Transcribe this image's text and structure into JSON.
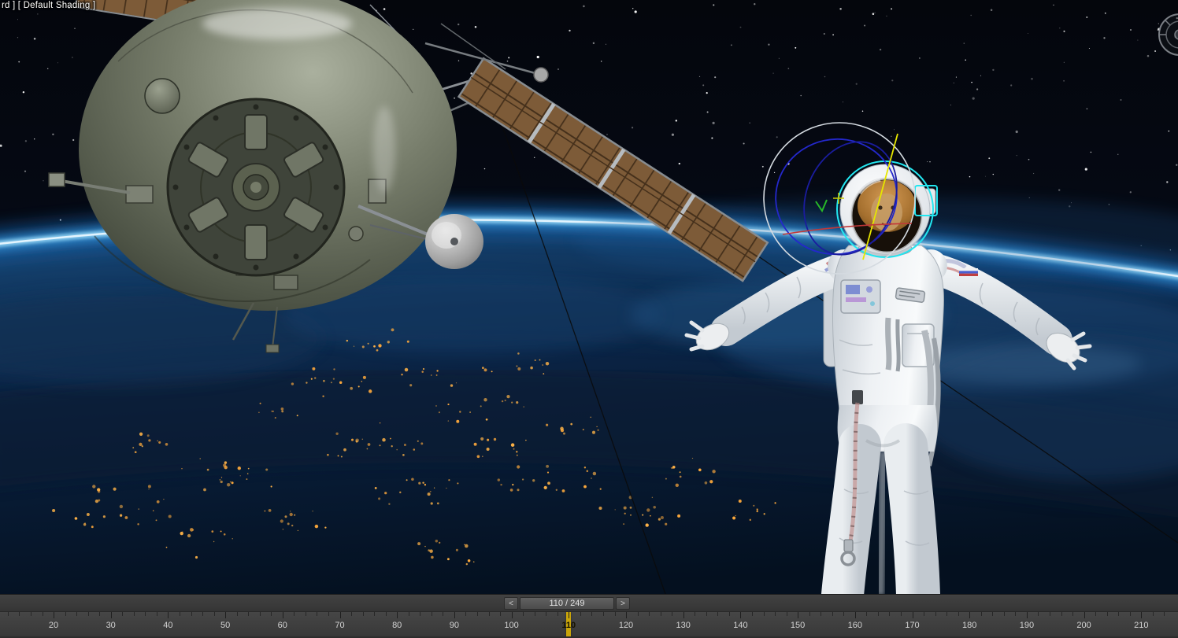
{
  "viewport": {
    "label_text": "rd ] [ Default Shading ]",
    "nav_gizmo_icon": "steering-wheel-navigation-icon"
  },
  "scene": {
    "objects": {
      "spacecraft": "soyuz-spacecraft",
      "solar_array": "solar-panel-array",
      "dish": "antenna-dish",
      "astronaut": "astronaut-model",
      "gizmo": "rotation-gizmo",
      "earth": "earth-horizon",
      "selection": "helmet-selection-highlight"
    }
  },
  "timeline": {
    "prev_button": "<",
    "next_button": ">",
    "frame_display": "110 / 249",
    "current_frame": "110",
    "end_frame": "249",
    "tick_labels": [
      "20",
      "30",
      "40",
      "50",
      "60",
      "70",
      "80",
      "90",
      "100",
      "110",
      "120",
      "130",
      "140",
      "150",
      "160",
      "170",
      "180",
      "190",
      "200",
      "210"
    ]
  },
  "colors": {
    "current_frame_marker": "#c9a50a",
    "timeline_bg": "#3a3a3a",
    "slider_bg": "#565656",
    "tick_text": "#d2d2d2",
    "gizmo_outer": "#d4dae0",
    "gizmo_blue": "#2428cc",
    "gizmo_blue_dark": "#1a1c9e",
    "gizmo_yellow": "#e6e600",
    "gizmo_red": "#c23838",
    "gizmo_green": "#28b828",
    "selection_cyan": "#22e6f0",
    "atmosphere_glow": "#8fd0f2",
    "city_lights": "#ffaa3c"
  }
}
